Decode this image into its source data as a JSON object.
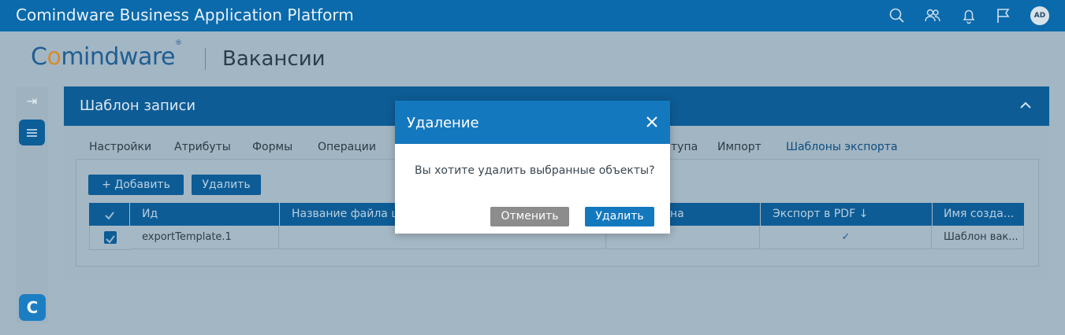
{
  "app": {
    "title": "Comindware Business Application Platform",
    "avatar": "AD"
  },
  "header": {
    "logo_pre": "C",
    "logo_o": "o",
    "logo_post": "mindware",
    "logo_reg": "®",
    "page_title": "Вакансии"
  },
  "panel": {
    "title": "Шаблон записи"
  },
  "tabs": [
    {
      "label": "Настройки"
    },
    {
      "label": "Атрибуты"
    },
    {
      "label": "Формы"
    },
    {
      "label": "Операции"
    },
    {
      "label": "тупа"
    },
    {
      "label": "Импорт"
    },
    {
      "label": "Шаблоны экспорта"
    }
  ],
  "toolbar": {
    "add_label": "+ Добавить",
    "delete_label": "Удалить"
  },
  "table": {
    "columns": [
      "Ид",
      "Название файла ша",
      "на",
      "Экспорт в PDF ↓",
      "Имя созда..."
    ],
    "rows": [
      {
        "id": "exportTemplate.1",
        "name_file": "",
        "col3": "",
        "pdf": "✓",
        "creator": "Шаблон вак..."
      }
    ]
  },
  "dialog": {
    "title": "Удаление",
    "message": "Вы хотите удалить выбранные объекты?",
    "cancel_label": "Отменить",
    "delete_label": "Удалить"
  },
  "colors": {
    "primary": "#1478be",
    "topbar": "#0a6aab",
    "cancel": "#8c8c8c"
  }
}
